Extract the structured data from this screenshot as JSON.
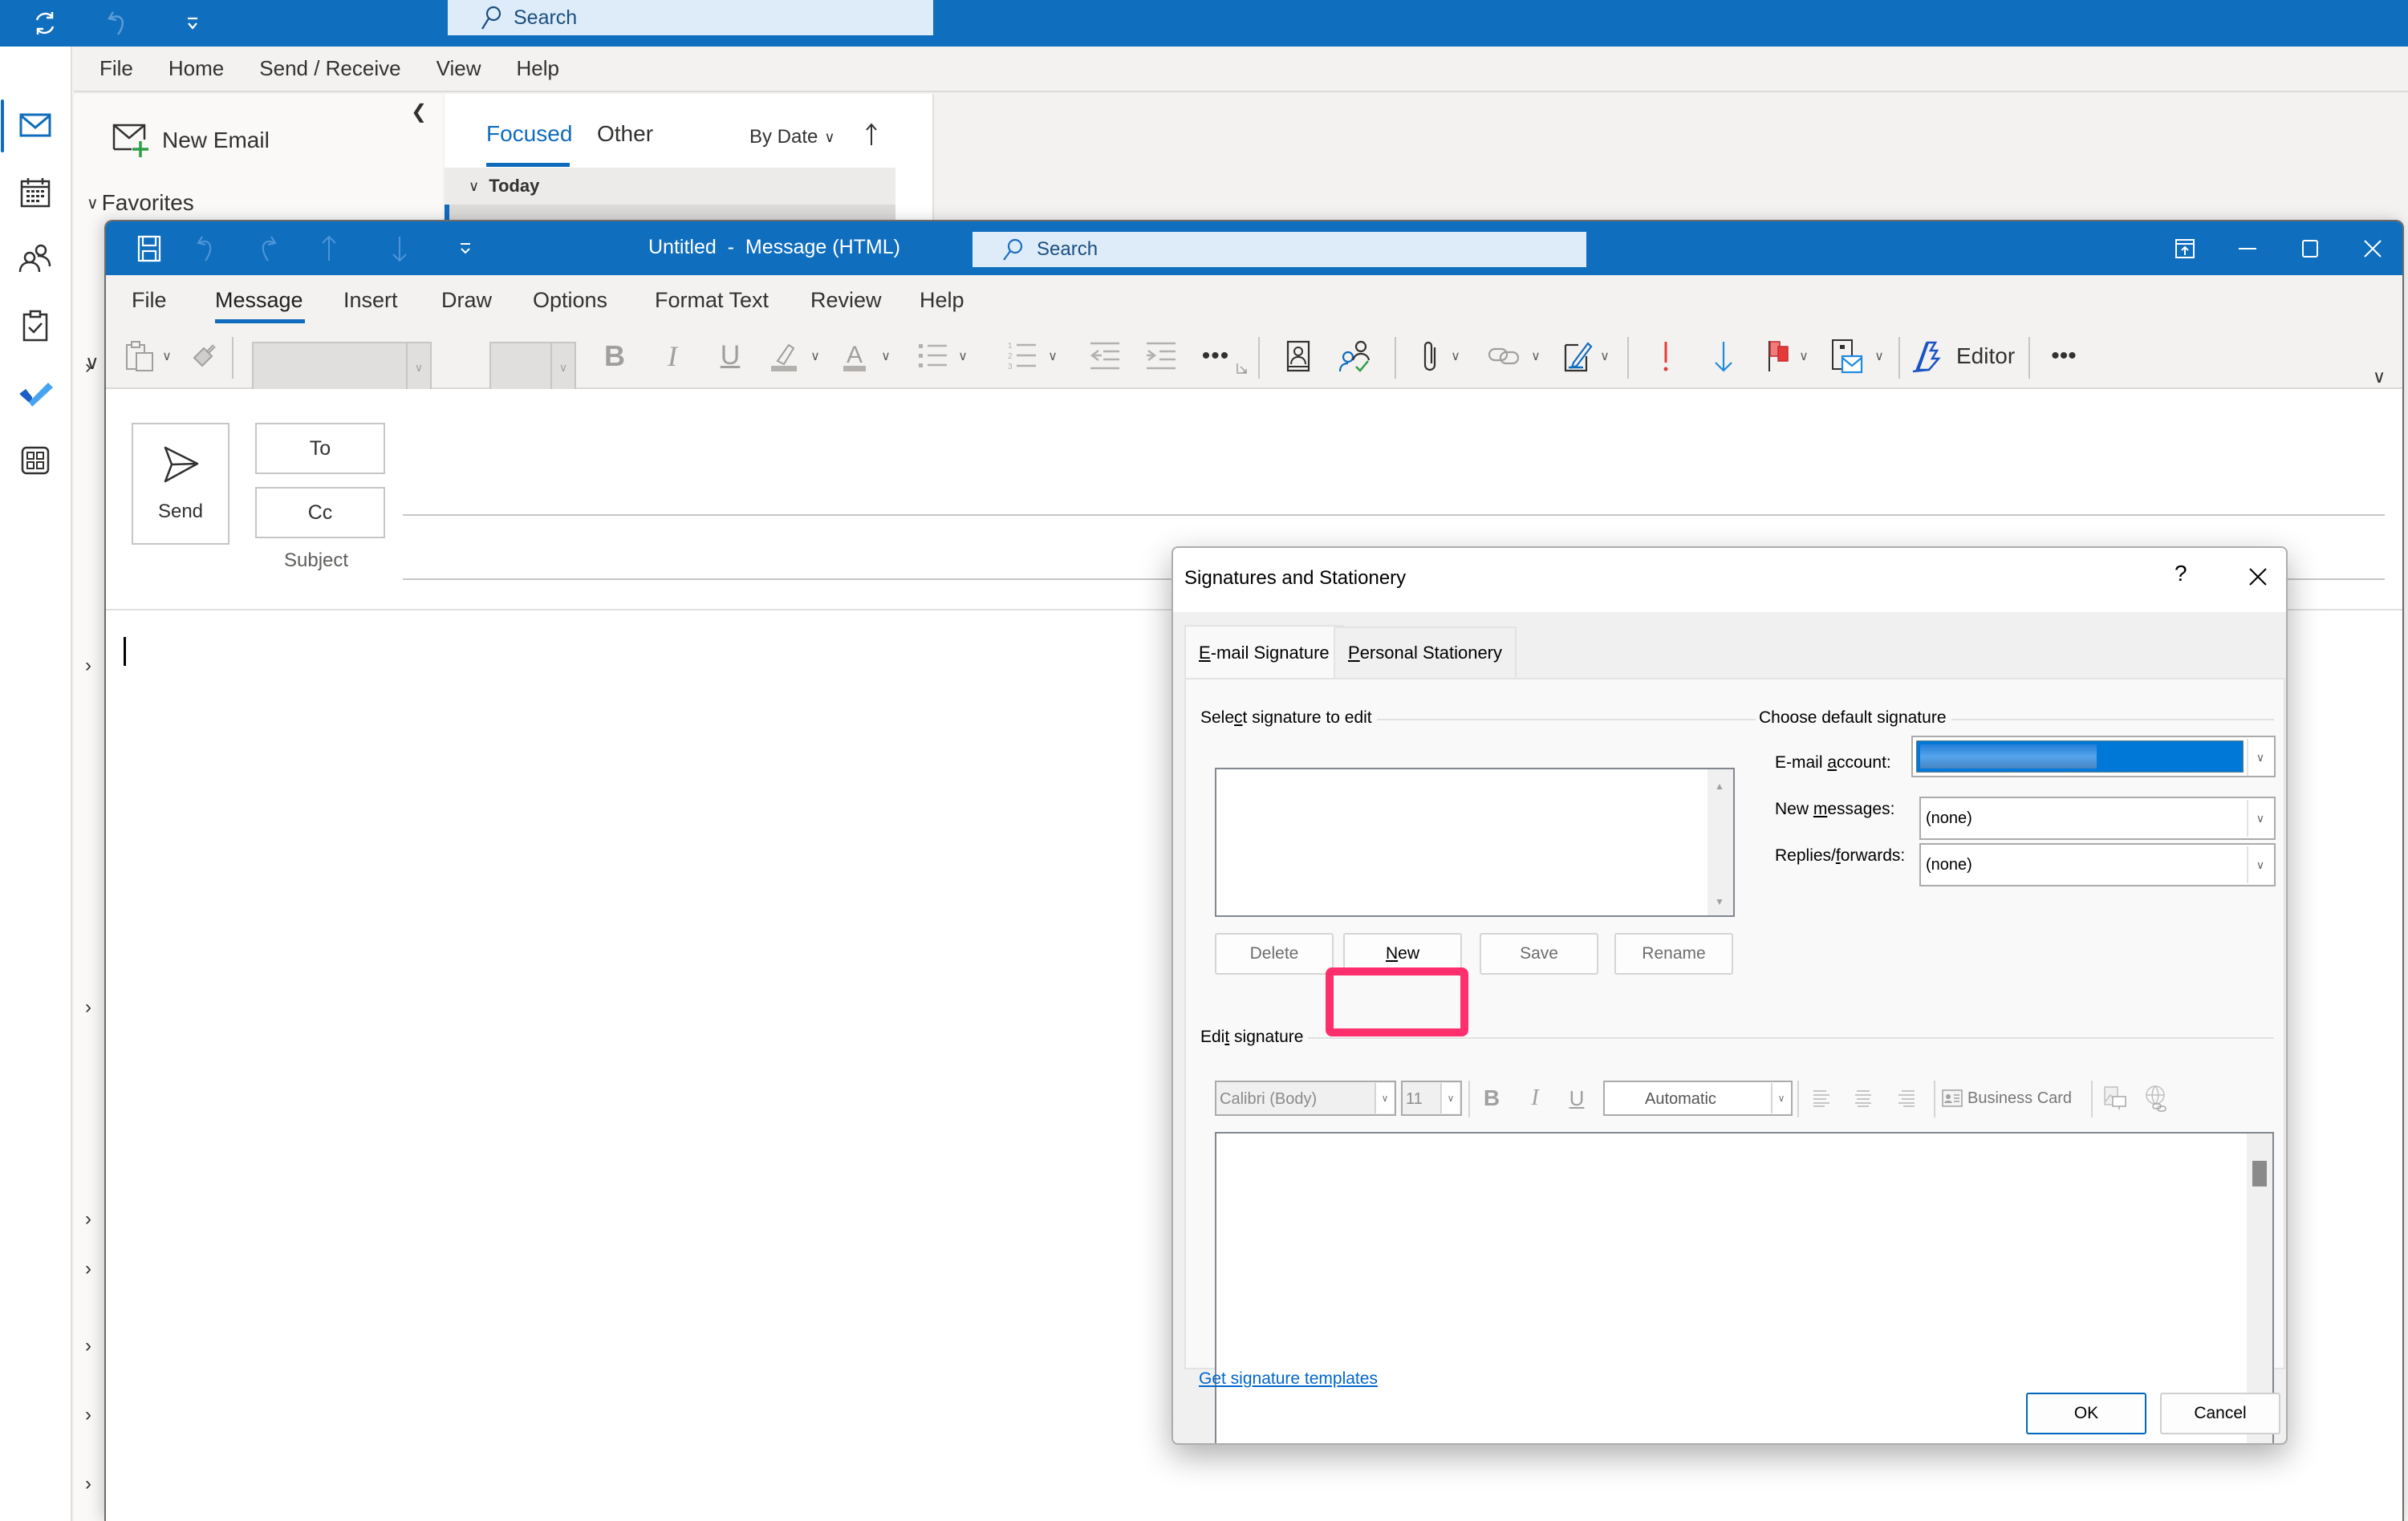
{
  "outer_app": {
    "search_placeholder": "Search",
    "menu": [
      "File",
      "Home",
      "Send / Receive",
      "View",
      "Help"
    ],
    "new_email_label": "New Email",
    "favorites_label": "Favorites",
    "message_list": {
      "tabs": [
        "Focused",
        "Other"
      ],
      "active_tab": "Focused",
      "sort_label": "By Date",
      "group_header": "Today"
    },
    "nav_rail": [
      "mail",
      "calendar",
      "people",
      "tasks",
      "to-do",
      "apps"
    ],
    "active_nav": "mail"
  },
  "compose": {
    "title": "Untitled  -  Message (HTML)",
    "search_placeholder": "Search",
    "tabs": [
      "File",
      "Message",
      "Insert",
      "Draw",
      "Options",
      "Format Text",
      "Review",
      "Help"
    ],
    "active_tab": "Message",
    "ribbon": {
      "font_name": "",
      "font_size": "",
      "editor_label": "Editor"
    },
    "send_label": "Send",
    "to_label": "To",
    "cc_label": "Cc",
    "subject_label": "Subject",
    "to_value": "",
    "cc_value": "",
    "subject_value": "",
    "body": ""
  },
  "dialog": {
    "title": "Signatures and Stationery",
    "help": "?",
    "tabs": {
      "email_signature": {
        "prefix": "",
        "accel": "E",
        "rest": "-mail Signature"
      },
      "personal_stationery": {
        "prefix": "",
        "accel": "P",
        "rest": "ersonal Stationery"
      }
    },
    "active_tab": "E-mail Signature",
    "select_group": {
      "prefix": "Sele",
      "accel": "c",
      "rest": "t signature to edit"
    },
    "signatures": [],
    "buttons": {
      "delete": "Delete",
      "new": {
        "accel": "N",
        "rest": "ew"
      },
      "save": "Save",
      "rename": "Rename"
    },
    "default_group": "Choose default signature",
    "email_account": {
      "label_prefix": "E-mail ",
      "label_accel": "a",
      "label_rest": "ccount:",
      "value": "[redacted]"
    },
    "new_messages": {
      "label_prefix": "New ",
      "label_accel": "m",
      "label_rest": "essages:",
      "value": "(none)"
    },
    "replies_forwards": {
      "label_prefix": "Replies/",
      "label_accel": "f",
      "label_rest": "orwards:",
      "value": "(none)"
    },
    "edit_group": {
      "prefix": "Edi",
      "accel": "t",
      "rest": " signature"
    },
    "edit_toolbar": {
      "font": "Calibri (Body)",
      "size": "11",
      "color": "Automatic",
      "business_card": "Business Card"
    },
    "templates_link": "Get signature templates",
    "ok": "OK",
    "cancel": "Cancel",
    "highlight_color": "#ff2e6c"
  }
}
